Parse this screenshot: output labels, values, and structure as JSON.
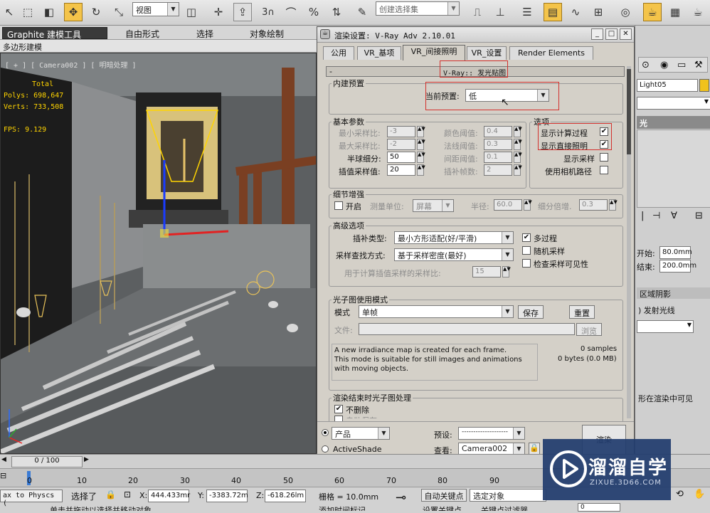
{
  "toolbar": {
    "view_combo": "视图",
    "selection_set_placeholder": "创建选择集",
    "snap_label": "3",
    "angle_label": "%"
  },
  "ribbon": {
    "tabs": [
      "Graphite 建模工具",
      "自由形式",
      "选择",
      "对象绘制"
    ],
    "sub": "多边形建模"
  },
  "viewport": {
    "label": "[ + ] [ Camera002 ] [ 明暗处理 ]",
    "stats_header": "Total",
    "polys": "Polys: 698,647",
    "verts": "Verts: 733,508",
    "fps": "FPS:    9.129"
  },
  "dialog": {
    "title": "渲染设置: V-Ray Adv 2.10.01",
    "tabs": [
      "公用",
      "VR_基项",
      "VR_间接照明",
      "VR_设置",
      "Render Elements"
    ],
    "rollout_title": "V-Ray:: 发光贴图",
    "builtin": {
      "group": "内建预置",
      "current_preset_label": "当前预置:",
      "current_preset_value": "低"
    },
    "basic": {
      "group": "基本参数",
      "min_rate_label": "最小采样比:",
      "min_rate": "-3",
      "max_rate_label": "最大采样比:",
      "max_rate": "-2",
      "hsph_label": "半球细分:",
      "hsph": "50",
      "interp_label": "插值采样值:",
      "interp": "20",
      "clr_thresh_label": "颜色阈值:",
      "clr_thresh": "0.4",
      "nrm_thresh_label": "法线阈值:",
      "nrm_thresh": "0.3",
      "dist_thresh_label": "间距阈值:",
      "dist_thresh": "0.1",
      "interp_frames_label": "插补帧数:",
      "interp_frames": "2"
    },
    "options": {
      "group": "选项",
      "show_calc": "显示计算过程",
      "show_direct": "显示直接照明",
      "show_samples": "显示采样",
      "use_camera_path": "使用相机路径"
    },
    "detail": {
      "group": "细节增强",
      "on": "开启",
      "scale_label": "测量单位:",
      "scale_value": "屏幕",
      "radius_label": "半径:",
      "radius": "60.0",
      "mult_label": "细分倍增.",
      "mult": "0.3"
    },
    "advanced": {
      "group": "高级选项",
      "interp_type_label": "插补类型:",
      "interp_type": "最小方形适配(好/平滑)",
      "lookup_label": "采样查找方式:",
      "lookup": "基于采样密度(最好)",
      "calc_pass_label": "用于计算插值采样的采样比:",
      "calc_pass": "15",
      "multipass": "多过程",
      "randomize": "随机采样",
      "check_vis": "检查采样可见性"
    },
    "mode": {
      "group": "光子图使用模式",
      "mode_label": "模式",
      "mode_value": "单帧",
      "save": "保存",
      "reset": "重置",
      "file_label": "文件:",
      "browse": "浏览",
      "description": "A new irradiance map is created for each frame.\nThis mode is suitable for still images and animations with moving objects.",
      "samples": "0 samples",
      "bytes": "0 bytes (0.0 MB)"
    },
    "after": {
      "group": "渲染结束时光子图处理",
      "dont_delete": "不删除",
      "auto_save": "自动保存:",
      "browse": "浏览"
    },
    "bottom": {
      "product": "产品",
      "activeshade": "ActiveShade",
      "preset_label": "预设:",
      "preset_value": "--------------------",
      "view_label": "查看:",
      "view_value": "Camera002",
      "render": "渲染"
    }
  },
  "right_panel": {
    "light_name": "Light05",
    "selected": "光",
    "start_label": "开始:",
    "start": "80.0mm",
    "end_label": "结束:",
    "end": "200.0mm",
    "area_shadow": "区域阴影",
    "emit_light": ") 发射光线",
    "visible_text": "形在渲染中可见",
    "params": "rams"
  },
  "timeline": {
    "frame": "0 / 100",
    "ticks": [
      "0",
      "10",
      "20",
      "30",
      "40",
      "50",
      "60",
      "70",
      "80",
      "90"
    ]
  },
  "status": {
    "maxscript": "ax to Physcs (",
    "selected": "选择了",
    "x_label": "X:",
    "x": "444.433mr",
    "y_label": "Y:",
    "y": "-3383.72m",
    "z_label": "Z:",
    "z": "-618.26lm",
    "grid": "栅格 = 10.0mm",
    "auto_key": "自动关键点",
    "selected_obj": "选定对象",
    "set_key": "设置关键点",
    "key_filters": "关键点过滤器",
    "prompt": "单击并拖动以选择并移动对象",
    "add_time_tag": "添加时间标记",
    "frame_field": "0"
  },
  "watermark": {
    "brand": "溜溜自学",
    "url": "ZIXUE.3D66.COM"
  }
}
